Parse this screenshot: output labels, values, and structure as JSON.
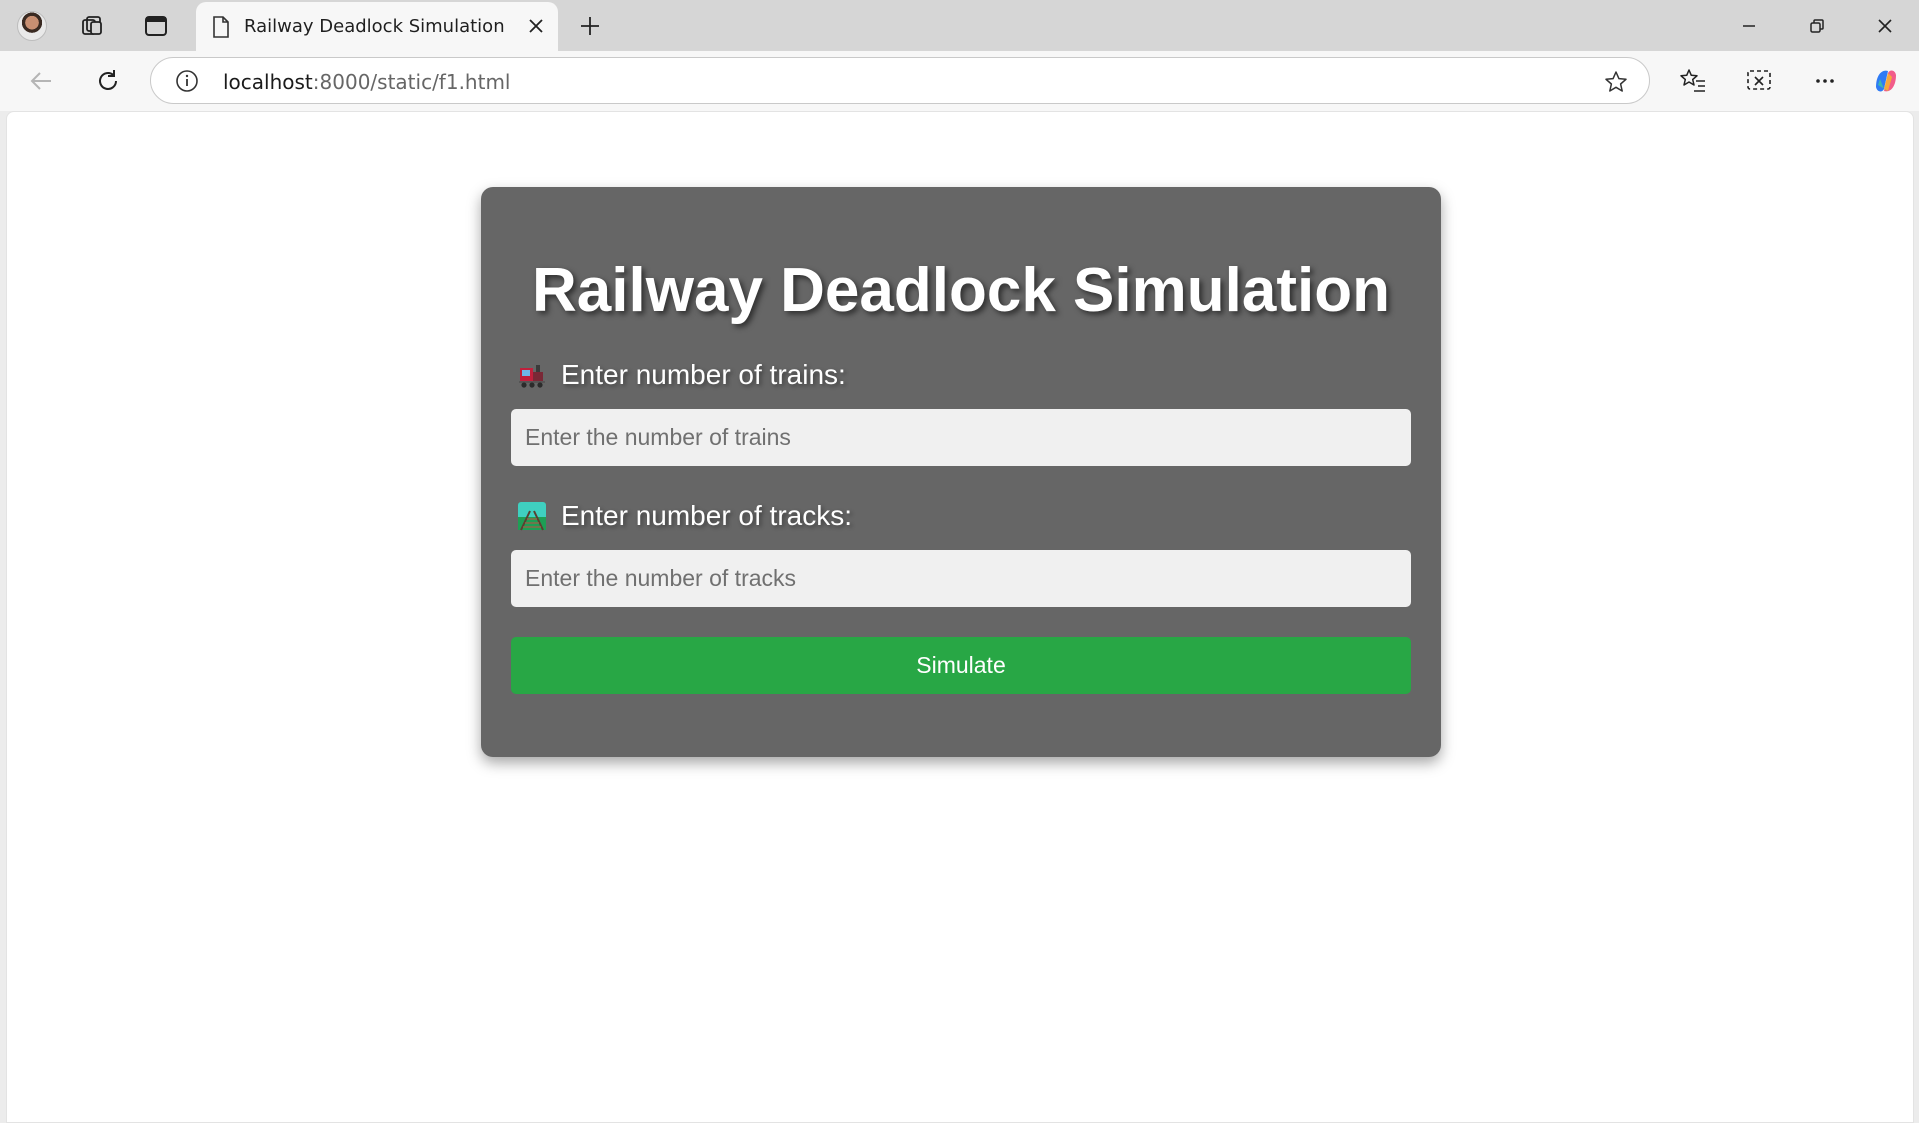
{
  "browser": {
    "tab": {
      "title": "Railway Deadlock Simulation"
    },
    "address": {
      "host": "localhost",
      "path": ":8000/static/f1.html"
    }
  },
  "page": {
    "title": "Railway Deadlock Simulation",
    "trains": {
      "label": "Enter number of trains:",
      "placeholder": "Enter the number of trains",
      "icon": "locomotive-icon"
    },
    "tracks": {
      "label": "Enter number of tracks:",
      "placeholder": "Enter the number of tracks",
      "icon": "railway-track-icon"
    },
    "simulate_label": "Simulate"
  },
  "colors": {
    "card_background": "#666666",
    "input_background": "#f0f0f0",
    "button_green": "#28a745",
    "titlebar": "#d6d6d6",
    "toolbar": "#f7f7f7"
  }
}
